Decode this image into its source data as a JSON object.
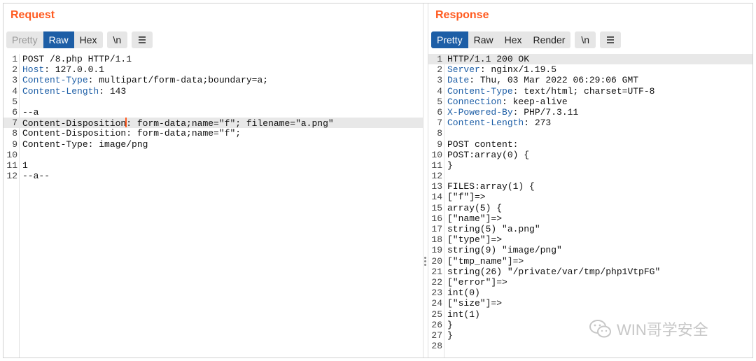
{
  "request": {
    "title": "Request",
    "tabs": [
      "Pretty",
      "Raw",
      "Hex"
    ],
    "active_tab": "Raw",
    "newline_label": "\\n",
    "lines": [
      {
        "n": "1",
        "key": "",
        "rest": "POST /8.php HTTP/1.1"
      },
      {
        "n": "2",
        "key": "Host",
        "rest": ": 127.0.0.1"
      },
      {
        "n": "3",
        "key": "Content-Type",
        "rest": ": multipart/form-data;boundary=a;"
      },
      {
        "n": "4",
        "key": "Content-Length",
        "rest": ": 143"
      },
      {
        "n": "5",
        "key": "",
        "rest": ""
      },
      {
        "n": "6",
        "key": "",
        "rest": "--a"
      },
      {
        "n": "7",
        "key": "",
        "rest_a": "Content-Disposition",
        "rest_b": ": form-data;name=\"f\"; filename=\"a.png\"",
        "highlight": true,
        "caret": true
      },
      {
        "n": "8",
        "key": "",
        "rest": "Content-Disposition: form-data;name=\"f\";"
      },
      {
        "n": "9",
        "key": "",
        "rest": "Content-Type: image/png"
      },
      {
        "n": "10",
        "key": "",
        "rest": ""
      },
      {
        "n": "11",
        "key": "",
        "rest": "1"
      },
      {
        "n": "12",
        "key": "",
        "rest": "--a--"
      }
    ]
  },
  "response": {
    "title": "Response",
    "tabs": [
      "Pretty",
      "Raw",
      "Hex",
      "Render"
    ],
    "active_tab": "Pretty",
    "newline_label": "\\n",
    "lines": [
      {
        "n": "1",
        "key": "",
        "rest": "HTTP/1.1 200 OK",
        "highlight": true
      },
      {
        "n": "2",
        "key": "Server",
        "rest": ": nginx/1.19.5"
      },
      {
        "n": "3",
        "key": "Date",
        "rest": ": Thu, 03 Mar 2022 06:29:06 GMT"
      },
      {
        "n": "4",
        "key": "Content-Type",
        "rest": ": text/html; charset=UTF-8"
      },
      {
        "n": "5",
        "key": "Connection",
        "rest": ": keep-alive"
      },
      {
        "n": "6",
        "key": "X-Powered-By",
        "rest": ": PHP/7.3.11"
      },
      {
        "n": "7",
        "key": "Content-Length",
        "rest": ": 273"
      },
      {
        "n": "8",
        "key": "",
        "rest": ""
      },
      {
        "n": "9",
        "key": "",
        "rest": "POST content:"
      },
      {
        "n": "10",
        "key": "",
        "rest": "POST:array(0) {"
      },
      {
        "n": "11",
        "key": "",
        "rest": "}"
      },
      {
        "n": "12",
        "key": "",
        "rest": ""
      },
      {
        "n": "13",
        "key": "",
        "rest": "FILES:array(1) {"
      },
      {
        "n": "14",
        "key": "",
        "rest": "[\"f\"]=>"
      },
      {
        "n": "15",
        "key": "",
        "rest": "array(5) {"
      },
      {
        "n": "16",
        "key": "",
        "rest": "[\"name\"]=>"
      },
      {
        "n": "17",
        "key": "",
        "rest": "string(5) \"a.png\""
      },
      {
        "n": "18",
        "key": "",
        "rest": "[\"type\"]=>"
      },
      {
        "n": "19",
        "key": "",
        "rest": "string(9) \"image/png\""
      },
      {
        "n": "20",
        "key": "",
        "rest": "[\"tmp_name\"]=>"
      },
      {
        "n": "21",
        "key": "",
        "rest": "string(26) \"/private/var/tmp/php1VtpFG\""
      },
      {
        "n": "22",
        "key": "",
        "rest": "[\"error\"]=>"
      },
      {
        "n": "23",
        "key": "",
        "rest": "int(0)"
      },
      {
        "n": "24",
        "key": "",
        "rest": "[\"size\"]=>"
      },
      {
        "n": "25",
        "key": "",
        "rest": "int(1)"
      },
      {
        "n": "26",
        "key": "",
        "rest": "}"
      },
      {
        "n": "27",
        "key": "",
        "rest": "}"
      },
      {
        "n": "28",
        "key": "",
        "rest": ""
      }
    ]
  },
  "watermark": {
    "text": "WIN哥学安全",
    "icon": "wechat-icon"
  },
  "colors": {
    "accent": "#ff5a1f",
    "active_tab": "#1d5ea6",
    "header_key": "#1d5ea6"
  }
}
